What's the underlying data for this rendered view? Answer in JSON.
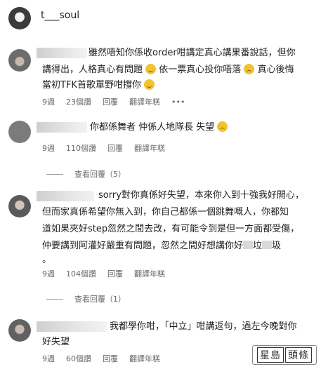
{
  "header": {
    "username": "t___soul"
  },
  "comments": [
    {
      "lines": [
        "雖然唔知你係收order咁講定真心講果番說話，但你",
        "講得出，人格真心有問題",
        "依一票真心投你唔落",
        "真心後悔",
        "當初TFK首歌單野咁撐你"
      ],
      "meta": {
        "time": "9週",
        "likes": "23個讚",
        "reply": "回覆",
        "translate": "翻譯年糕",
        "more": "•••"
      }
    },
    {
      "lines": [
        "你都係舞者 仲係人地隊長 失望"
      ],
      "meta": {
        "time": "9週",
        "likes": "110個讚",
        "reply": "回覆",
        "translate": "翻譯年糕"
      },
      "view_replies": "查看回覆（5）"
    },
    {
      "lines": [
        "sorry對你真係好失望，本來你入到十強我好開心，",
        "但而家真係希望你無入到，你自己都係一個跳舞嘅人，你都知",
        "道如果夾好step忽然之間去改，有可能令到是但一方面都受傷，",
        "仲要講到阿灌好嚴重有問題，忽然之間好想講你好",
        "垃",
        "圾",
        "。"
      ],
      "meta": {
        "time": "9週",
        "likes": "104個讚",
        "reply": "回覆",
        "translate": "翻譯年糕"
      },
      "view_replies": "查看回覆（1）"
    },
    {
      "lines": [
        "我都學你咁，「中立」咁講返句，過左今晚對你",
        "好失望"
      ],
      "meta": {
        "time": "9週",
        "likes": "60個讚",
        "reply": "回覆",
        "translate": "翻譯年糕"
      }
    }
  ],
  "watermark": {
    "text1": "星島",
    "text2": "頭條"
  },
  "colors": {
    "emoji": "#f2c331",
    "meta": "#666666",
    "text": "#1f1f1f"
  }
}
